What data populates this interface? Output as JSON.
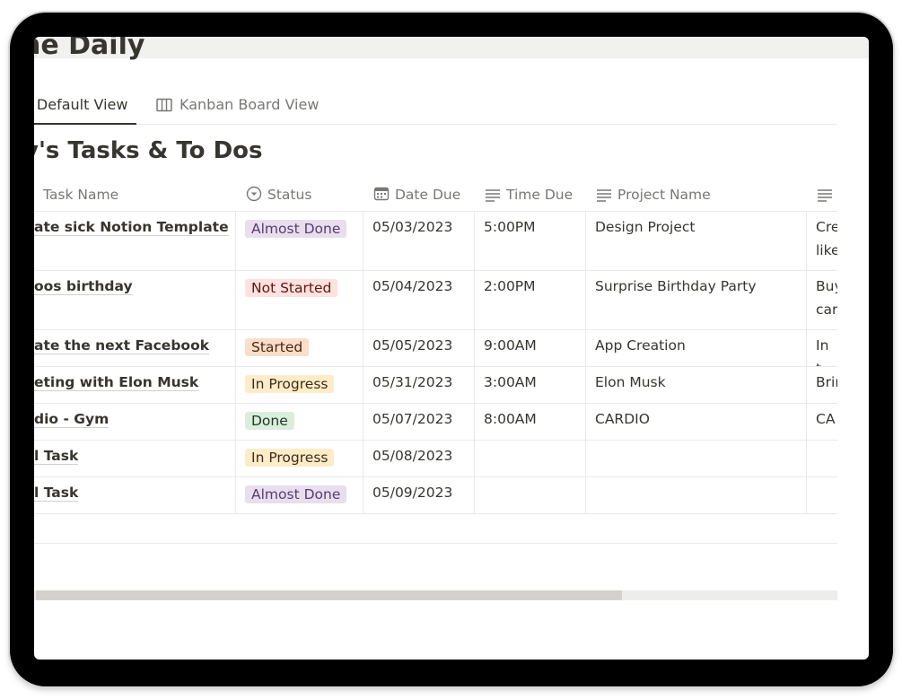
{
  "page": {
    "title": "ne Daily"
  },
  "tabs": [
    {
      "label": "e Default View",
      "active": true
    },
    {
      "label": "Kanban Board View",
      "icon": "board-columns-icon"
    }
  ],
  "section": {
    "title": "y's Tasks & To Dos"
  },
  "table": {
    "headers": {
      "name": "Task Name",
      "status": "Status",
      "date": "Date Due",
      "time": "Time Due",
      "project": "Project Name",
      "desc": ""
    },
    "rows": [
      {
        "name": "ate sick Notion Template",
        "status": "Almost Done",
        "date": "05/03/2023",
        "time": "5:00PM",
        "project": "Design Project",
        "desc": "Cre like"
      },
      {
        "name": "oos birthday",
        "status": "Not Started",
        "date": "05/04/2023",
        "time": "2:00PM",
        "project": "Surprise Birthday Party",
        "desc": "Buy car"
      },
      {
        "name": "ate the next Facebook",
        "status": "Started",
        "date": "05/05/2023",
        "time": "9:00AM",
        "project": "App Creation",
        "desc": "In t"
      },
      {
        "name": "eting with Elon Musk",
        "status": "In Progress",
        "date": "05/31/2023",
        "time": "3:00AM",
        "project": "Elon Musk",
        "desc": "Brin"
      },
      {
        "name": "dio - Gym",
        "status": "Done",
        "date": "05/07/2023",
        "time": "8:00AM",
        "project": "CARDIO",
        "desc": "CA"
      },
      {
        "name": "l Task",
        "status": "In Progress",
        "date": "05/08/2023",
        "time": "",
        "project": "",
        "desc": ""
      },
      {
        "name": "l Task",
        "status": "Almost Done",
        "date": "05/09/2023",
        "time": "",
        "project": "",
        "desc": ""
      }
    ]
  },
  "status_colors": {
    "Almost Done": {
      "bg": "#e8deee",
      "fg": "#5a3c6e"
    },
    "Not Started": {
      "bg": "#ffe2dd",
      "fg": "#5d1715"
    },
    "Started": {
      "bg": "#fadec9",
      "fg": "#49290e"
    },
    "In Progress": {
      "bg": "#fdecc8",
      "fg": "#402c1b"
    },
    "Done": {
      "bg": "#dbeddb",
      "fg": "#1c3829"
    }
  },
  "scrollbar": {
    "position": 0.73
  }
}
